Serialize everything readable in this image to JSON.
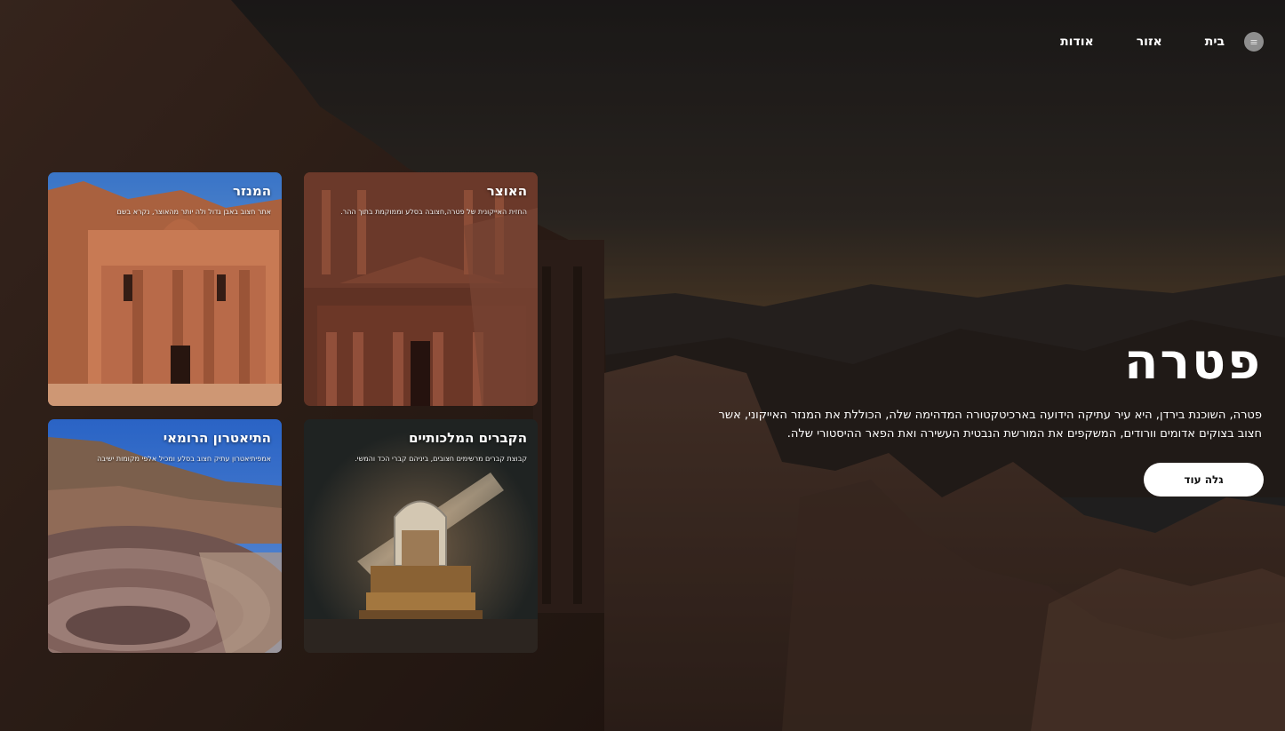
{
  "nav": {
    "menu_icon": "menu-icon",
    "links": [
      {
        "label": "בית"
      },
      {
        "label": "אזור"
      },
      {
        "label": "אודות"
      }
    ]
  },
  "hero": {
    "title": "פטרה",
    "description": "פטרה, השוכנת בירדן, היא עיר עתיקה הידועה בארכיטקטורה המדהימה שלה, הכוללת את המנזר האייקוני, אשר חצוב בצוקים אדומים וורודים, המשקפים את המורשת הנבטית העשירה ואת הפאר ההיסטורי שלה.",
    "cta_label": "גלה עוד"
  },
  "cards": {
    "monastery": {
      "title": "המנזר",
      "description": "אתר חצוב באבן גדול ולה יותר מהאוצר, נקרא בשם"
    },
    "treasury": {
      "title": "האוצר",
      "description": "החזית האייקונית של פטרה,חצובה בסלע וממוקמת בתוך ההר."
    },
    "theater": {
      "title": "התיאטרון הרומאי",
      "description": "אמפיתיאטרון עתיק חצוב בסלע ומכיל אלפי מקומות ישיבה"
    },
    "tombs": {
      "title": "הקברים המלכותיים",
      "description": "קבוצת קברים מרשימים חצובים, ביניהם קברי הכד והמשי."
    }
  }
}
